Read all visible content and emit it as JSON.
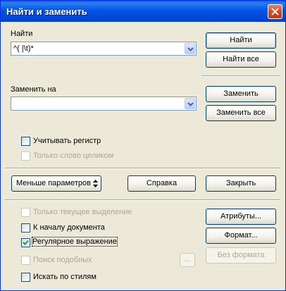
{
  "window": {
    "title": "Найти и заменить"
  },
  "find": {
    "label": "Найти",
    "value": "^( |\\t)*"
  },
  "replace": {
    "label": "Заменить на",
    "value": ""
  },
  "buttons": {
    "find": "Найти",
    "find_all": "Найти все",
    "replace": "Заменить",
    "replace_all": "Заменить все",
    "fewer_options": "Меньше параметров",
    "help": "Справка",
    "close": "Закрыть",
    "attributes": "Атрибуты...",
    "format": "Формат...",
    "no_format": "Без формата",
    "similar_dots": "..."
  },
  "options": {
    "match_case": {
      "label": "Учитывать регистр",
      "checked": false,
      "enabled": true
    },
    "whole_words": {
      "label": "Только слово целиком",
      "checked": false,
      "enabled": false
    },
    "current_selection": {
      "label": "Только текущее выделение",
      "checked": false,
      "enabled": false
    },
    "backwards": {
      "label": "К началу документа",
      "checked": false,
      "enabled": true
    },
    "regex": {
      "label": "Регулярное выражение",
      "checked": true,
      "enabled": true
    },
    "similarity": {
      "label": "Поиск подобных",
      "checked": false,
      "enabled": false
    },
    "styles": {
      "label": "Искать по стилям",
      "checked": false,
      "enabled": true
    }
  },
  "icons": {
    "close": "close-icon",
    "dropdown": "chevron-down-icon",
    "updown": "up-down-arrows-icon",
    "check": "checkmark-icon"
  },
  "colors": {
    "titlebar": "#0055e5",
    "close_button": "#d4441c",
    "dialog_bg": "#ece9d8",
    "disabled_text": "#aca899"
  }
}
